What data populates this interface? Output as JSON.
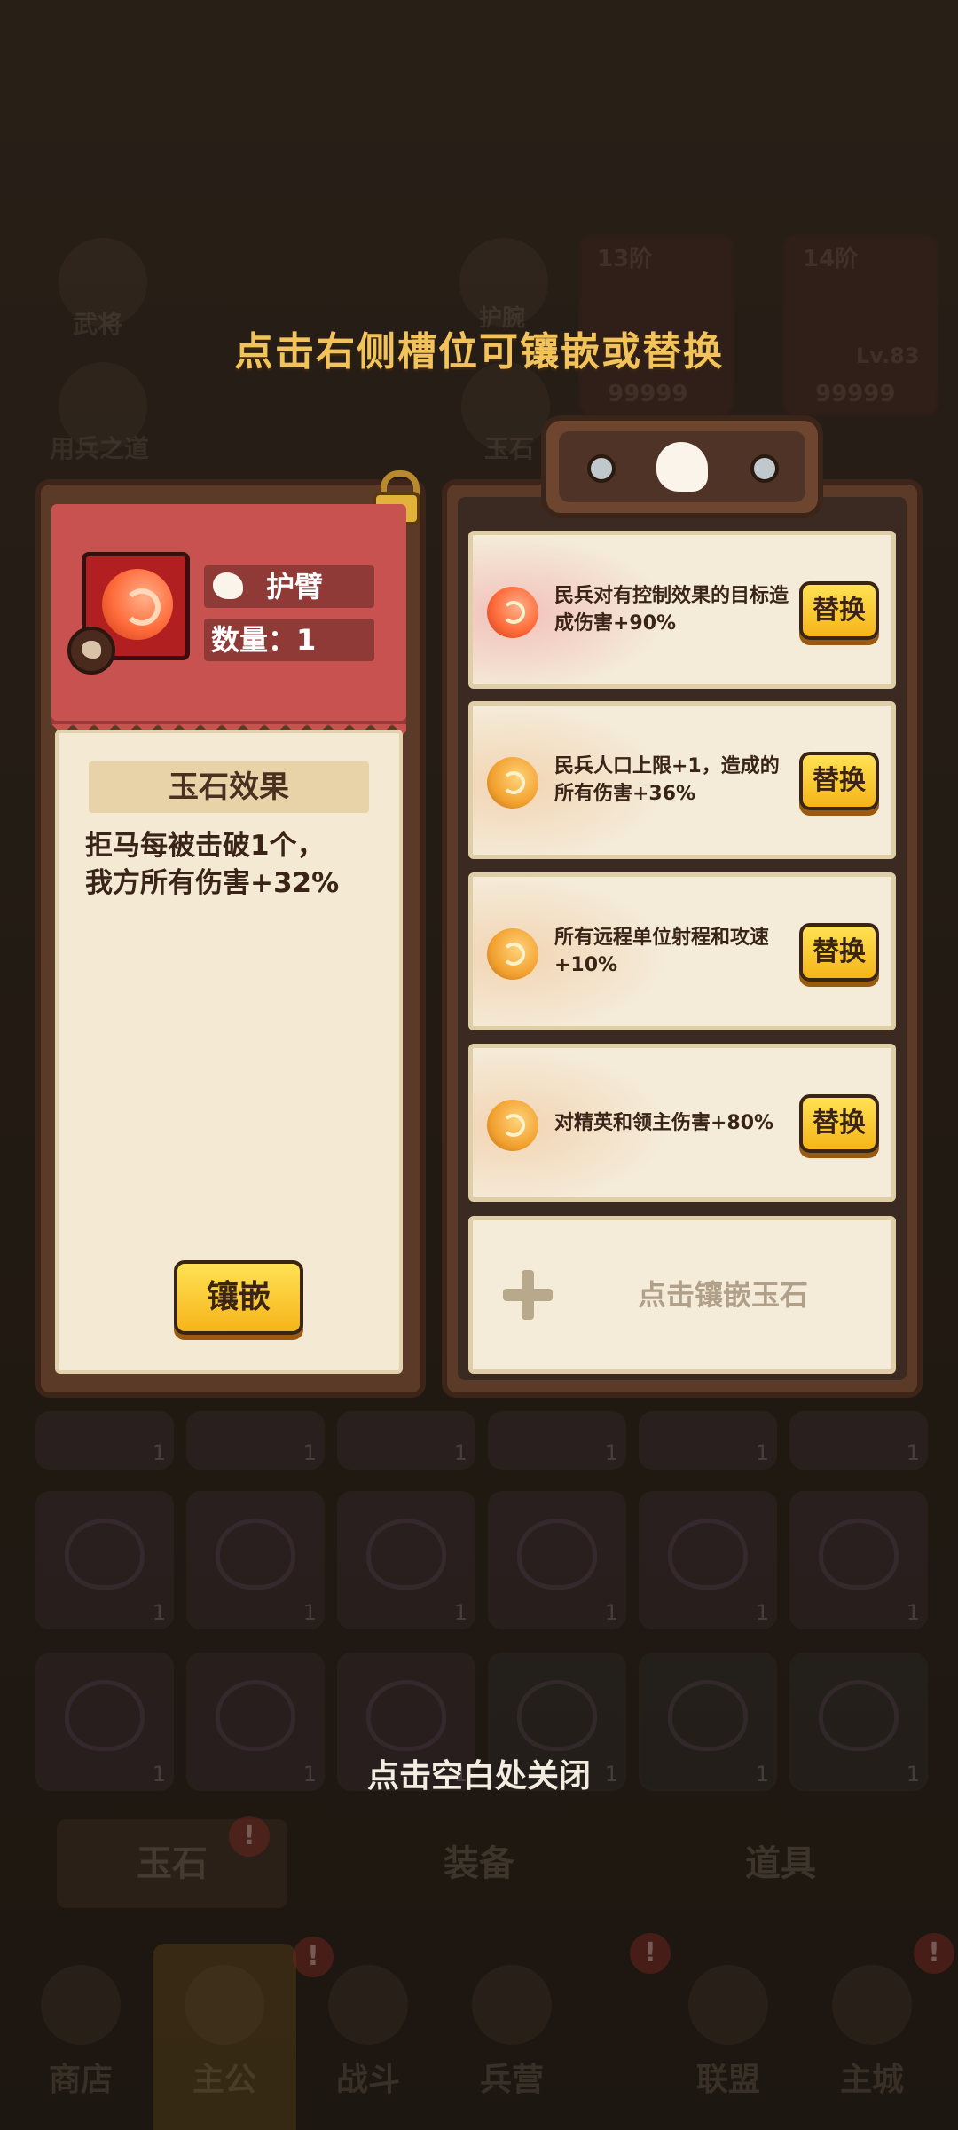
{
  "hints": {
    "top": "点击右侧槽位可镶嵌或替换",
    "bottom": "点击空白处关闭"
  },
  "background": {
    "menu_labels": [
      "武将",
      "用兵之道",
      "护腕",
      "玉石"
    ],
    "cards": [
      {
        "tier": "13阶",
        "score": "99999"
      },
      {
        "tier": "14阶",
        "level": "Lv.83",
        "score": "99999"
      }
    ],
    "tabs": [
      "玉石",
      "装备",
      "道具"
    ],
    "tab_badge": "!",
    "nav": [
      "商店",
      "主公",
      "战斗",
      "兵营",
      "联盟",
      "主城"
    ],
    "nav_badge": "!"
  },
  "item": {
    "name": "护臂",
    "count_label": "数量：1",
    "effect_title": "玉石效果",
    "effect_text": "拒马每被击破1个，\n我方所有伤害+32%",
    "inlay_button": "镶嵌"
  },
  "slots": [
    {
      "gem": "red-jade-icon",
      "text": "民兵对有控制效果的目标造成伤害+90%",
      "button": "替换"
    },
    {
      "gem": "orange-jade-icon",
      "text": "民兵人口上限+1，造成的所有伤害+36%",
      "button": "替换"
    },
    {
      "gem": "orange-jade-icon",
      "text": "所有远程单位射程和攻速+10%",
      "button": "替换"
    },
    {
      "gem": "orange-jade-icon",
      "text": "对精英和领主伤害+80%",
      "button": "替换"
    }
  ],
  "empty_slot": {
    "label": "点击镶嵌玉石"
  },
  "colors": {
    "hint_gold": "#f2c35a",
    "panel_brown": "#5b3b28",
    "banner_red": "#c8524f",
    "button_yellow": "#ffd231",
    "paper": "#f4ead4"
  }
}
